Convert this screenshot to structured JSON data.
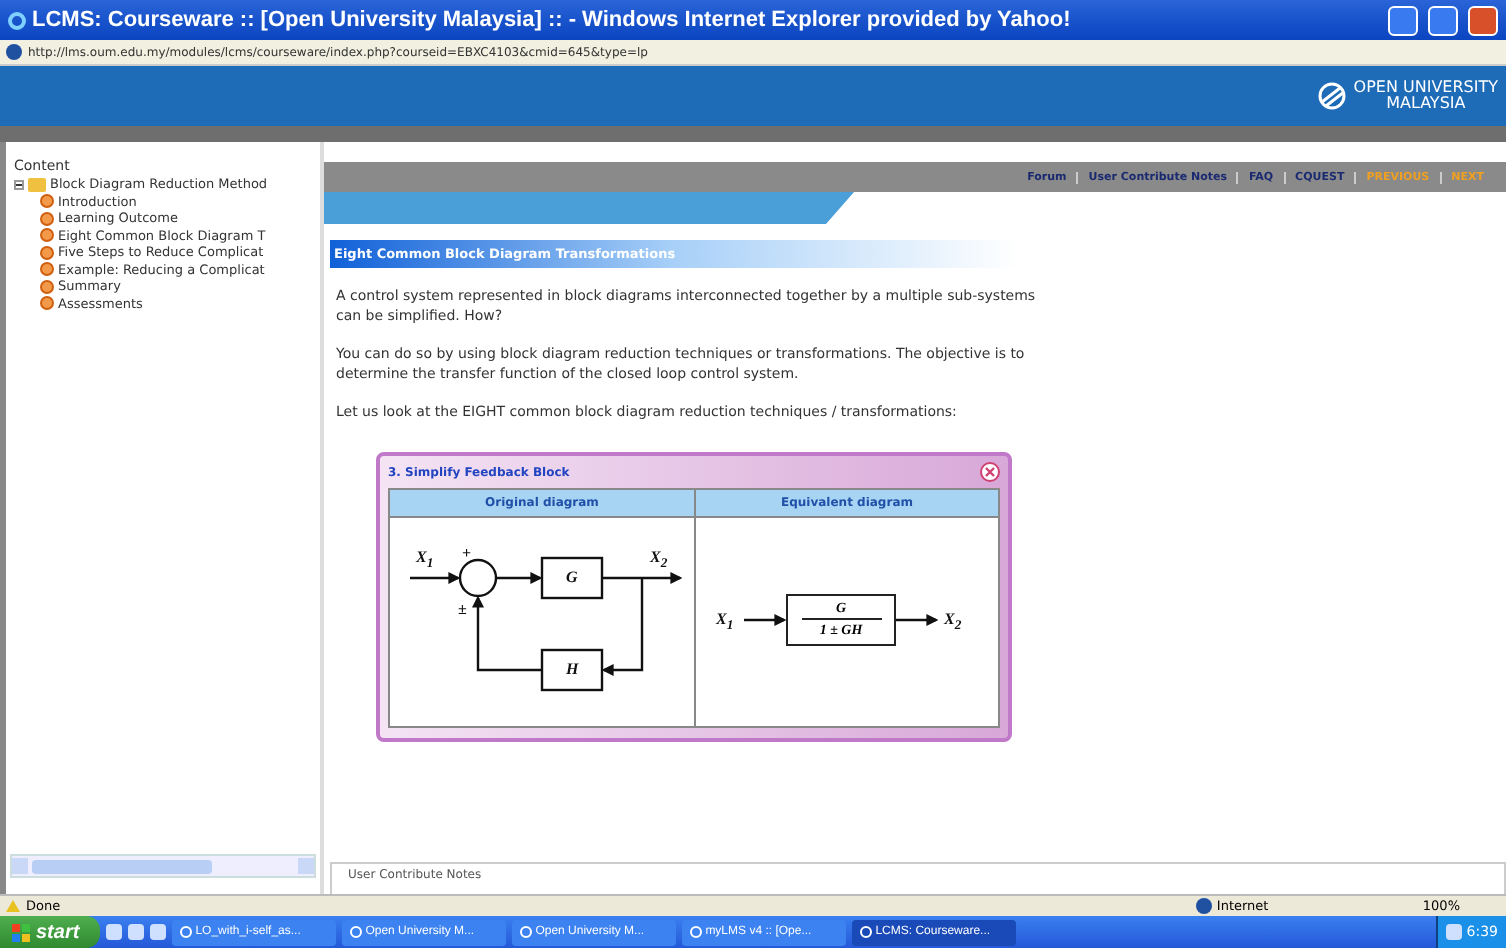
{
  "window": {
    "title": "LCMS: Courseware :: [Open University Malaysia] :: - Windows Internet Explorer provided by Yahoo!"
  },
  "address_bar": {
    "url": "http://lms.oum.edu.my/modules/lcms/courseware/index.php?courseid=EBXC4103&cmid=645&type=lp"
  },
  "banner": {
    "logo_line1": "OPEN UNIVERSITY",
    "logo_line2": "MALAYSIA"
  },
  "sidebar": {
    "title": "Content",
    "tree": [
      {
        "label": "Block Diagram Reduction Method",
        "expanded": true,
        "children": [
          {
            "label": "Introduction"
          },
          {
            "label": "Learning Outcome"
          },
          {
            "label": "Eight Common Block Diagram T"
          },
          {
            "label": "Five Steps to Reduce Complicat"
          },
          {
            "label": "Example: Reducing a Complicat"
          },
          {
            "label": "Summary"
          },
          {
            "label": "Assessments"
          }
        ]
      }
    ]
  },
  "nav_links": [
    {
      "label": "Forum",
      "kind": "plain"
    },
    {
      "label": "User Contribute Notes",
      "kind": "plain"
    },
    {
      "label": "FAQ",
      "kind": "plain"
    },
    {
      "label": "CQUEST",
      "kind": "plain"
    },
    {
      "label": "PREVIOUS",
      "kind": "highlight"
    },
    {
      "label": "NEXT",
      "kind": "highlight"
    }
  ],
  "content": {
    "heading": "Eight Common Block Diagram Transformations",
    "paragraphs": [
      "A control system represented in block diagrams interconnected together by a multiple sub-systems can be simplified. How?",
      "You can do so by using block diagram reduction techniques or transformations. The objective is to determine the transfer function of the closed loop control system.",
      "Let us look at the EIGHT common block diagram reduction techniques / transformations:"
    ],
    "dialog": {
      "title": "3. Simplify Feedback Block",
      "columns": [
        "Original diagram",
        "Equivalent diagram"
      ],
      "original": {
        "input": "X$_{1}$",
        "plus": "+",
        "plus_minus": "±",
        "forward": "G",
        "output": "X$_{2}$",
        "feedback": "H"
      },
      "equivalent": {
        "input": "X$_{1}$",
        "numerator": "G",
        "denominator": "1 ± GH",
        "output": "X$_{2}$"
      }
    },
    "notes_title": "User Contribute Notes"
  },
  "status_bar": {
    "status": "Done",
    "zone": "Internet",
    "zoom": "100%"
  },
  "taskbar": {
    "start": "start",
    "tasks": [
      {
        "label": "LO_with_i-self_as...",
        "selected": false
      },
      {
        "label": "Open University M...",
        "selected": false
      },
      {
        "label": "Open University M...",
        "selected": false
      },
      {
        "label": "myLMS v4 :: [Ope...",
        "selected": false
      },
      {
        "label": "LCMS: Courseware...",
        "selected": true
      }
    ],
    "clock": "6:39"
  }
}
